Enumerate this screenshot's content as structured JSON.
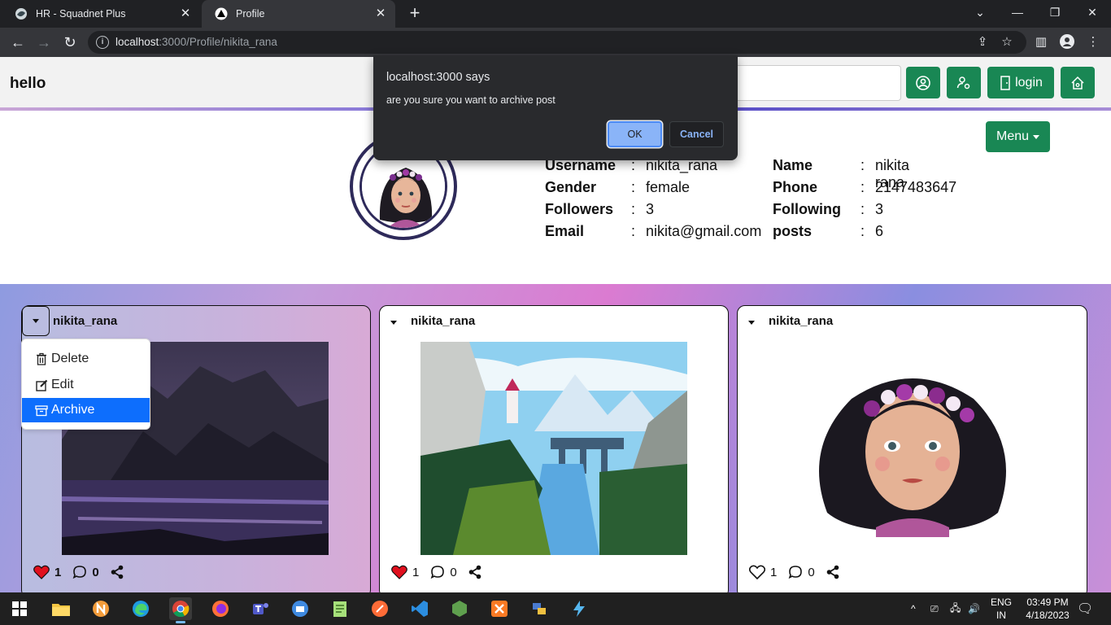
{
  "browser": {
    "tabs": [
      {
        "title": "HR - Squadnet Plus"
      },
      {
        "title": "Profile"
      }
    ],
    "url_host": "localhost",
    "url_rest": ":3000/Profile/nikita_rana"
  },
  "navbar": {
    "brand": "hello",
    "login_label": "login"
  },
  "menu": {
    "label": "Menu"
  },
  "profile": {
    "fields_left": [
      {
        "key": "Username",
        "value": "nikita_rana"
      },
      {
        "key": "Gender",
        "value": "female"
      },
      {
        "key": "Followers",
        "value": "3"
      },
      {
        "key": "Email",
        "value": "nikita@gmail.com"
      }
    ],
    "fields_right": [
      {
        "key": "Name",
        "value": "nikita rana"
      },
      {
        "key": "Phone",
        "value": "2147483647"
      },
      {
        "key": "Following",
        "value": "3"
      },
      {
        "key": "posts",
        "value": "6"
      }
    ],
    "colon": ":"
  },
  "posts": [
    {
      "user": "nikita_rana",
      "likes": "1",
      "comments": "0",
      "liked": true
    },
    {
      "user": "nikita_rana",
      "likes": "1",
      "comments": "0",
      "liked": true
    },
    {
      "user": "nikita_rana",
      "likes": "1",
      "comments": "0",
      "liked": false
    }
  ],
  "post_menu": {
    "items": [
      {
        "label": "Delete",
        "icon": "trash-icon"
      },
      {
        "label": "Edit",
        "icon": "edit-icon"
      },
      {
        "label": "Archive",
        "icon": "archive-icon"
      }
    ]
  },
  "dialog": {
    "title": "localhost:3000 says",
    "message": "are you sure you want to archive post",
    "ok": "OK",
    "cancel": "Cancel"
  },
  "taskbar": {
    "lang_top": "ENG",
    "lang_bottom": "IN",
    "time": "03:49 PM",
    "date": "4/18/2023"
  },
  "colors": {
    "green": "#198754",
    "active_blue": "#0d6efd",
    "like_red": "#e0101e"
  }
}
